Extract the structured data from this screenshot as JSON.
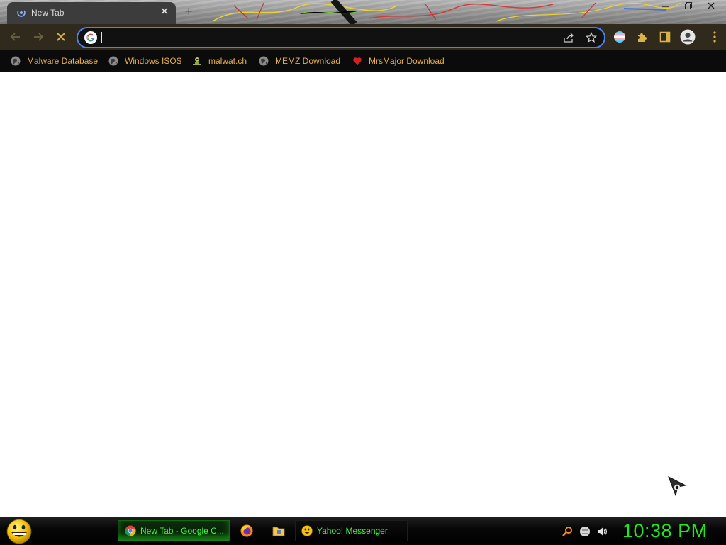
{
  "browser": {
    "tab": {
      "title": "New Tab",
      "close_glyph": "✕",
      "favicon": "loading-spinner-icon"
    },
    "new_tab_glyph": "+",
    "window_controls": [
      "minimize-icon",
      "restore-icon",
      "close-icon"
    ],
    "toolbar": {
      "back_icon": "arrow-left-icon",
      "forward_icon": "arrow-right-icon",
      "stop_icon": "stop-x-icon",
      "address_value": "",
      "address_placeholder": "",
      "omnibox_icons": [
        "share-icon",
        "bookmark-star-icon"
      ],
      "extension_icons": [
        "flag-extension-icon",
        "puzzle-extensions-icon",
        "side-panel-icon",
        "profile-avatar-icon"
      ]
    },
    "bookmarks": [
      {
        "label": "Malware Database",
        "icon": "globe-icon"
      },
      {
        "label": "Windows ISOS",
        "icon": "globe-icon"
      },
      {
        "label": "malwat.ch",
        "icon": "malwatch-icon"
      },
      {
        "label": "MEMZ Download",
        "icon": "globe-icon"
      },
      {
        "label": "MrsMajor Download",
        "icon": "heart-icon"
      }
    ],
    "colors": {
      "toolbar": "#2f2a1c",
      "bookmark_text": "#e9b04a",
      "omnibox_border": "#4d83f1"
    }
  },
  "taskbar": {
    "start_icon": "smiley-start-icon",
    "items": [
      {
        "label": "New Tab - Google C...",
        "icon": "chrome-icon",
        "active": true
      },
      {
        "label": "Yahoo! Messenger",
        "icon": "yahoo-smiley-icon",
        "active": false
      }
    ],
    "quick_launch": [
      "firefox-icon",
      "folder-icon"
    ],
    "tray": [
      "search-icon",
      "network-icon",
      "volume-icon"
    ],
    "clock": "10:38 PM",
    "colors": {
      "taskbar_text": "#39ff39",
      "clock": "#1ee81e"
    }
  }
}
